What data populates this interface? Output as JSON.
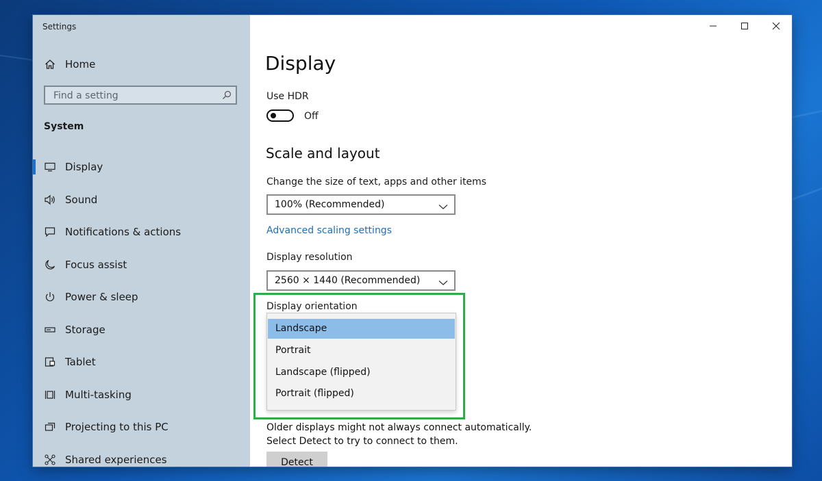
{
  "window": {
    "title": "Settings",
    "controls": {
      "minimize": "minimize-icon",
      "maximize": "maximize-icon",
      "close": "close-icon"
    }
  },
  "sidebar": {
    "home_label": "Home",
    "search_placeholder": "Find a setting",
    "section_title": "System",
    "items": [
      {
        "label": "Display",
        "icon": "monitor-icon",
        "active": true
      },
      {
        "label": "Sound",
        "icon": "speaker-icon"
      },
      {
        "label": "Notifications & actions",
        "icon": "notification-icon"
      },
      {
        "label": "Focus assist",
        "icon": "moon-icon"
      },
      {
        "label": "Power & sleep",
        "icon": "power-icon"
      },
      {
        "label": "Storage",
        "icon": "storage-icon"
      },
      {
        "label": "Tablet",
        "icon": "tablet-icon"
      },
      {
        "label": "Multi-tasking",
        "icon": "multitasking-icon"
      },
      {
        "label": "Projecting to this PC",
        "icon": "projecting-icon"
      },
      {
        "label": "Shared experiences",
        "icon": "shared-icon"
      }
    ]
  },
  "main": {
    "page_title": "Display",
    "hdr": {
      "label": "Use HDR",
      "state": "Off"
    },
    "scale_heading": "Scale and layout",
    "scale_label": "Change the size of text, apps and other items",
    "scale_value": "100% (Recommended)",
    "advanced_link": "Advanced scaling settings",
    "resolution_label": "Display resolution",
    "resolution_value": "2560 × 1440 (Recommended)",
    "orientation_label": "Display orientation",
    "orientation_options": [
      "Landscape",
      "Portrait",
      "Landscape (flipped)",
      "Portrait (flipped)"
    ],
    "orientation_selected": "Landscape",
    "detect_note": "Older displays might not always connect automatically. Select Detect to try to connect to them.",
    "detect_button": "Detect"
  },
  "colors": {
    "accent": "#1a73c8",
    "sidebar_bg": "#c4d2dd",
    "selected_option": "#8cbde9",
    "highlight_box": "#2eab4b",
    "link": "#1f6fb8"
  }
}
